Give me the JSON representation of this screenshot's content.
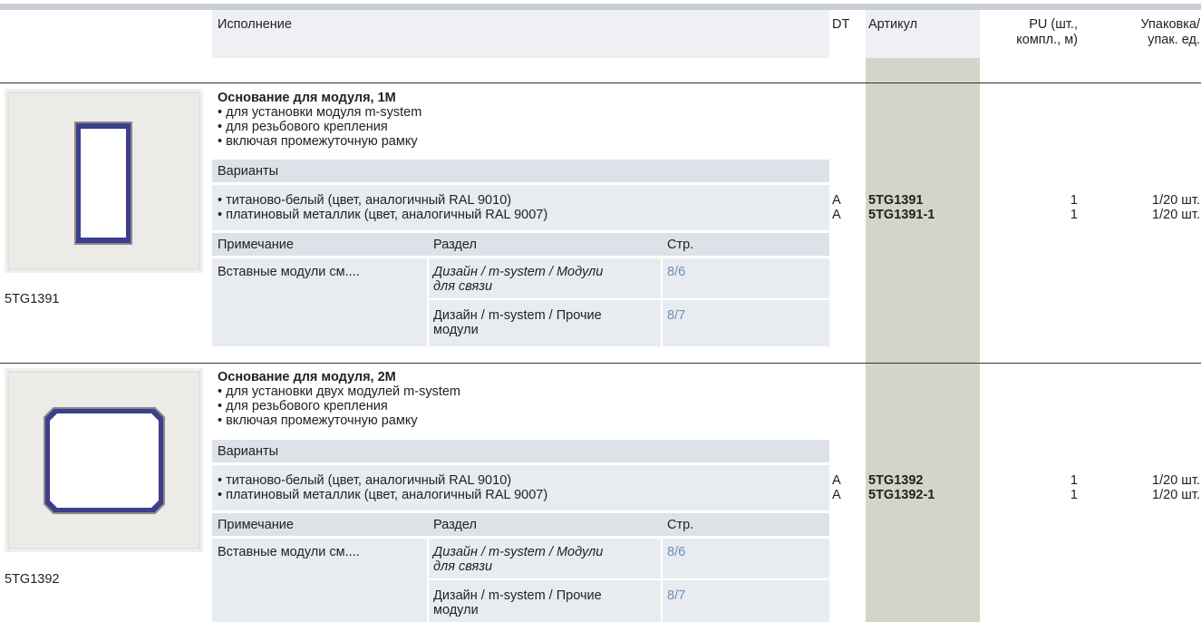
{
  "header": {
    "col_execution": "Исполнение",
    "col_dt": "DT",
    "col_article": "Артикул",
    "col_pu_1": "PU (шт.,",
    "col_pu_2": "компл., м)",
    "col_pack_1": "Упаковка/",
    "col_pack_2": "упак. ед."
  },
  "products": [
    {
      "code": "5TG1391",
      "title": "Основание для модуля, 1M",
      "bullets": [
        "• для установки модуля m-system",
        "• для резьбового крепления",
        "• включая промежуточную рамку"
      ],
      "variants_label": "Варианты",
      "variants": [
        {
          "name": "• титаново-белый (цвет, аналогичный RAL 9010)",
          "dt": "A",
          "article": "5TG1391",
          "pu": "1",
          "pack": "1/20 шт."
        },
        {
          "name": "• платиновый металлик (цвет, аналогичный RAL 9007)",
          "dt": "A",
          "article": "5TG1391-1",
          "pu": "1",
          "pack": "1/20 шт."
        }
      ],
      "notes_header": {
        "note": "Примечание",
        "section": "Раздел",
        "page": "Стр."
      },
      "notes_text": "Вставные модули см....",
      "refs": [
        {
          "section_1": "Дизайн / m-system / Модули",
          "section_2": "для связи",
          "page": "8/6",
          "italic": true
        },
        {
          "section_1": "Дизайн / m-system / Прочие",
          "section_2": "модули",
          "page": "8/7",
          "italic": false
        }
      ]
    },
    {
      "code": "5TG1392",
      "title": "Основание для модуля, 2M",
      "bullets": [
        "• для установки двух модулей m-system",
        "• для резьбового крепления",
        "• включая промежуточную рамку"
      ],
      "variants_label": "Варианты",
      "variants": [
        {
          "name": "• титаново-белый (цвет, аналогичный RAL 9010)",
          "dt": "A",
          "article": "5TG1392",
          "pu": "1",
          "pack": "1/20 шт."
        },
        {
          "name": "• платиновый металлик (цвет, аналогичный RAL 9007)",
          "dt": "A",
          "article": "5TG1392-1",
          "pu": "1",
          "pack": "1/20 шт."
        }
      ],
      "notes_header": {
        "note": "Примечание",
        "section": "Раздел",
        "page": "Стр."
      },
      "notes_text": "Вставные модули см....",
      "refs": [
        {
          "section_1": "Дизайн / m-system / Модули",
          "section_2": "для связи",
          "page": "8/6",
          "italic": true
        },
        {
          "section_1": "Дизайн / m-system / Прочие",
          "section_2": "модули",
          "page": "8/7",
          "italic": false
        }
      ]
    }
  ]
}
